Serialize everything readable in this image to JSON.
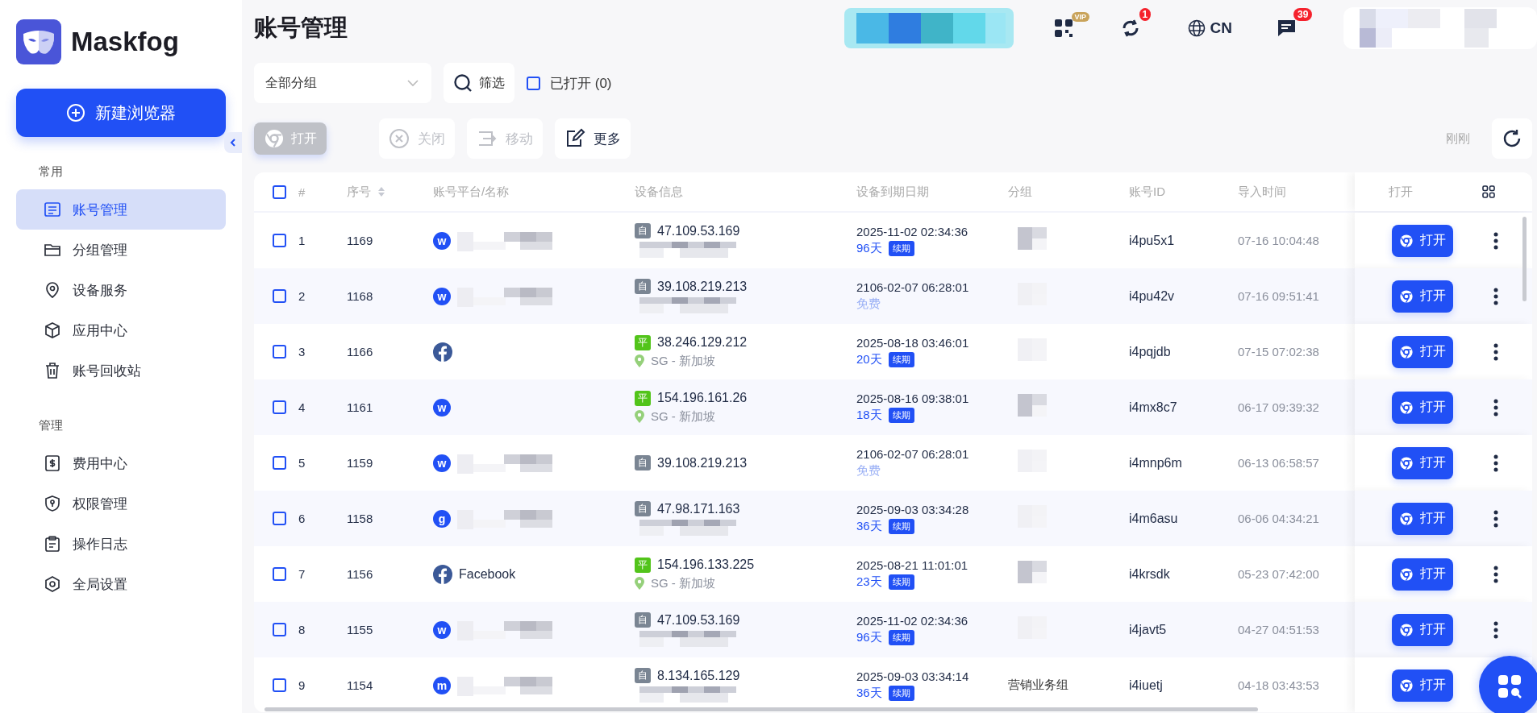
{
  "sidebar": {
    "brand": "Maskfog",
    "new_button": "新建浏览器",
    "sections": [
      {
        "title": "常用",
        "items": [
          {
            "label": "账号管理",
            "selected": true
          },
          {
            "label": "分组管理",
            "selected": false
          },
          {
            "label": "设备服务",
            "selected": false
          },
          {
            "label": "应用中心",
            "selected": false
          },
          {
            "label": "账号回收站",
            "selected": false
          }
        ]
      },
      {
        "title": "管理",
        "items": [
          {
            "label": "费用中心",
            "selected": false
          },
          {
            "label": "权限管理",
            "selected": false
          },
          {
            "label": "操作日志",
            "selected": false
          },
          {
            "label": "全局设置",
            "selected": false
          }
        ]
      }
    ]
  },
  "header": {
    "title": "账号管理",
    "vip_badge": "VIP",
    "sync_badge": "1",
    "language": "CN",
    "message_badge": "39"
  },
  "toolbar": {
    "group_select": "全部分组",
    "filter_button": "筛选",
    "opened_filter": {
      "label": "已打开 (0)",
      "checked": false
    },
    "actions": [
      {
        "label": "打开",
        "disabled": true,
        "kind": "open"
      },
      {
        "label": "关闭",
        "disabled": true,
        "kind": "close"
      },
      {
        "label": "移动",
        "disabled": true,
        "kind": "move"
      },
      {
        "label": "更多",
        "disabled": false,
        "kind": "more"
      }
    ],
    "refreshed": "刚刚"
  },
  "table": {
    "columns": [
      "#",
      "序号",
      "账号平台/名称",
      "设备信息",
      "设备到期日期",
      "分组",
      "账号ID",
      "导入时间",
      "打开"
    ],
    "all_checked": false,
    "rows": [
      {
        "checked": false,
        "index": "1",
        "serial": "1169",
        "platform": {
          "kind": "letter",
          "letter": "w"
        },
        "name_blurred": true,
        "device": {
          "tag": "自",
          "color": "#7a8593",
          "ip": "47.109.53.169",
          "detail_blurred": true
        },
        "expiry": {
          "date": "2025-11-02 02:34:36",
          "kind": "paid",
          "days": "96天",
          "renew": "续期"
        },
        "group_blurred": true,
        "account_id": "i4pu5x1",
        "imported": "07-16 10:04:48",
        "open": "打开"
      },
      {
        "checked": false,
        "index": "2",
        "serial": "1168",
        "platform": {
          "kind": "letter",
          "letter": "w"
        },
        "name_blurred": true,
        "device": {
          "tag": "自",
          "color": "#7a8593",
          "ip": "39.108.219.213",
          "detail_blurred": true
        },
        "expiry": {
          "date": "2106-02-07 06:28:01",
          "kind": "free",
          "note": "免费"
        },
        "group_blurred": true,
        "account_id": "i4pu42v",
        "imported": "07-16 09:51:41",
        "open": "打开"
      },
      {
        "checked": false,
        "index": "3",
        "serial": "1166",
        "platform": {
          "kind": "facebook"
        },
        "name_blurred": false,
        "device": {
          "tag": "平",
          "color": "#52c41a",
          "ip": "38.246.129.212",
          "location": "SG - 新加坡",
          "detail_blurred": false
        },
        "expiry": {
          "date": "2025-08-18 03:46:01",
          "kind": "paid",
          "days": "20天",
          "renew": "续期"
        },
        "group_blurred": true,
        "account_id": "i4pqjdb",
        "imported": "07-15 07:02:38",
        "open": "打开"
      },
      {
        "checked": false,
        "index": "4",
        "serial": "1161",
        "platform": {
          "kind": "letter",
          "letter": "w"
        },
        "name_blurred": false,
        "device": {
          "tag": "平",
          "color": "#52c41a",
          "ip": "154.196.161.26",
          "location": "SG - 新加坡",
          "detail_blurred": false
        },
        "expiry": {
          "date": "2025-08-16 09:38:01",
          "kind": "paid",
          "days": "18天",
          "renew": "续期"
        },
        "group_blurred": true,
        "account_id": "i4mx8c7",
        "imported": "06-17 09:39:32",
        "open": "打开"
      },
      {
        "checked": false,
        "index": "5",
        "serial": "1159",
        "platform": {
          "kind": "letter",
          "letter": "w"
        },
        "name_blurred": true,
        "device": {
          "tag": "自",
          "color": "#7a8593",
          "ip": "39.108.219.213",
          "detail_blurred": false
        },
        "expiry": {
          "date": "2106-02-07 06:28:01",
          "kind": "free",
          "note": "免费"
        },
        "group_blurred": true,
        "account_id": "i4mnp6m",
        "imported": "06-13 06:58:57",
        "open": "打开"
      },
      {
        "checked": false,
        "index": "6",
        "serial": "1158",
        "platform": {
          "kind": "letter",
          "letter": "g"
        },
        "name_blurred": true,
        "device": {
          "tag": "自",
          "color": "#7a8593",
          "ip": "47.98.171.163",
          "detail_blurred": true
        },
        "expiry": {
          "date": "2025-09-03 03:34:28",
          "kind": "paid",
          "days": "36天",
          "renew": "续期"
        },
        "group_blurred": true,
        "account_id": "i4m6asu",
        "imported": "06-06 04:34:21",
        "open": "打开"
      },
      {
        "checked": false,
        "index": "7",
        "serial": "1156",
        "platform": {
          "kind": "facebook"
        },
        "name": "Facebook",
        "name_blurred": false,
        "device": {
          "tag": "平",
          "color": "#52c41a",
          "ip": "154.196.133.225",
          "location": "SG - 新加坡",
          "detail_blurred": false
        },
        "expiry": {
          "date": "2025-08-21 11:01:01",
          "kind": "paid",
          "days": "23天",
          "renew": "续期"
        },
        "group_blurred": true,
        "account_id": "i4krsdk",
        "imported": "05-23 07:42:00",
        "open": "打开"
      },
      {
        "checked": false,
        "index": "8",
        "serial": "1155",
        "platform": {
          "kind": "letter",
          "letter": "w"
        },
        "name_blurred": true,
        "device": {
          "tag": "自",
          "color": "#7a8593",
          "ip": "47.109.53.169",
          "detail_blurred": true
        },
        "expiry": {
          "date": "2025-11-02 02:34:36",
          "kind": "paid",
          "days": "96天",
          "renew": "续期"
        },
        "group_blurred": true,
        "account_id": "i4javt5",
        "imported": "04-27 04:51:53",
        "open": "打开"
      },
      {
        "checked": false,
        "index": "9",
        "serial": "1154",
        "platform": {
          "kind": "letter",
          "letter": "m"
        },
        "name_blurred": true,
        "device": {
          "tag": "自",
          "color": "#7a8593",
          "ip": "8.134.165.129",
          "detail_blurred": true
        },
        "expiry": {
          "date": "2025-09-03 03:34:14",
          "kind": "paid",
          "days": "36天",
          "renew": "续期"
        },
        "group": "营销业务组",
        "group_blurred": false,
        "account_id": "i4iuetj",
        "imported": "04-18 03:43:53",
        "open": "打开"
      }
    ]
  }
}
